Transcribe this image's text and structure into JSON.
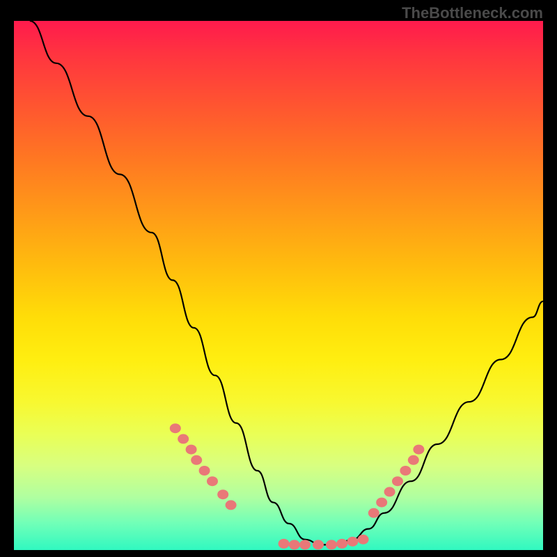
{
  "watermark": "TheBottleneck.com",
  "chart_data": {
    "type": "line",
    "title": "",
    "xlabel": "",
    "ylabel": "",
    "xlim": [
      0,
      100
    ],
    "ylim": [
      0,
      100
    ],
    "curve": {
      "name": "bottleneck-curve",
      "x": [
        3,
        8,
        14,
        20,
        26,
        30,
        34,
        38,
        42,
        46,
        49,
        52,
        55,
        58,
        61,
        64,
        67,
        70,
        75,
        80,
        86,
        92,
        98,
        100
      ],
      "y": [
        100,
        92,
        82,
        71,
        60,
        51,
        42,
        33,
        24,
        15,
        9,
        5,
        2,
        1,
        1,
        2,
        4,
        7,
        13,
        20,
        28,
        36,
        44,
        47
      ]
    },
    "markers_left": {
      "x": [
        30.5,
        32,
        33.5,
        34.5,
        36,
        37.5,
        39.5,
        41
      ],
      "y": [
        23,
        21,
        19,
        17,
        15,
        13,
        10.5,
        8.5
      ]
    },
    "markers_bottom": {
      "x": [
        51,
        53,
        55,
        57.5,
        60,
        62,
        64,
        66
      ],
      "y": [
        1.2,
        1,
        1,
        1,
        1,
        1.2,
        1.6,
        2
      ]
    },
    "markers_right": {
      "x": [
        68,
        69.5,
        71,
        72.5,
        74,
        75.5,
        76.5
      ],
      "y": [
        7,
        9,
        11,
        13,
        15,
        17,
        19
      ]
    },
    "gradient_stops": [
      {
        "pos": 0,
        "color": "#ff1a4d"
      },
      {
        "pos": 16,
        "color": "#ff5530"
      },
      {
        "pos": 36,
        "color": "#ff9918"
      },
      {
        "pos": 56,
        "color": "#ffdd08"
      },
      {
        "pos": 78,
        "color": "#eaff55"
      },
      {
        "pos": 100,
        "color": "#30f8c0"
      }
    ]
  }
}
